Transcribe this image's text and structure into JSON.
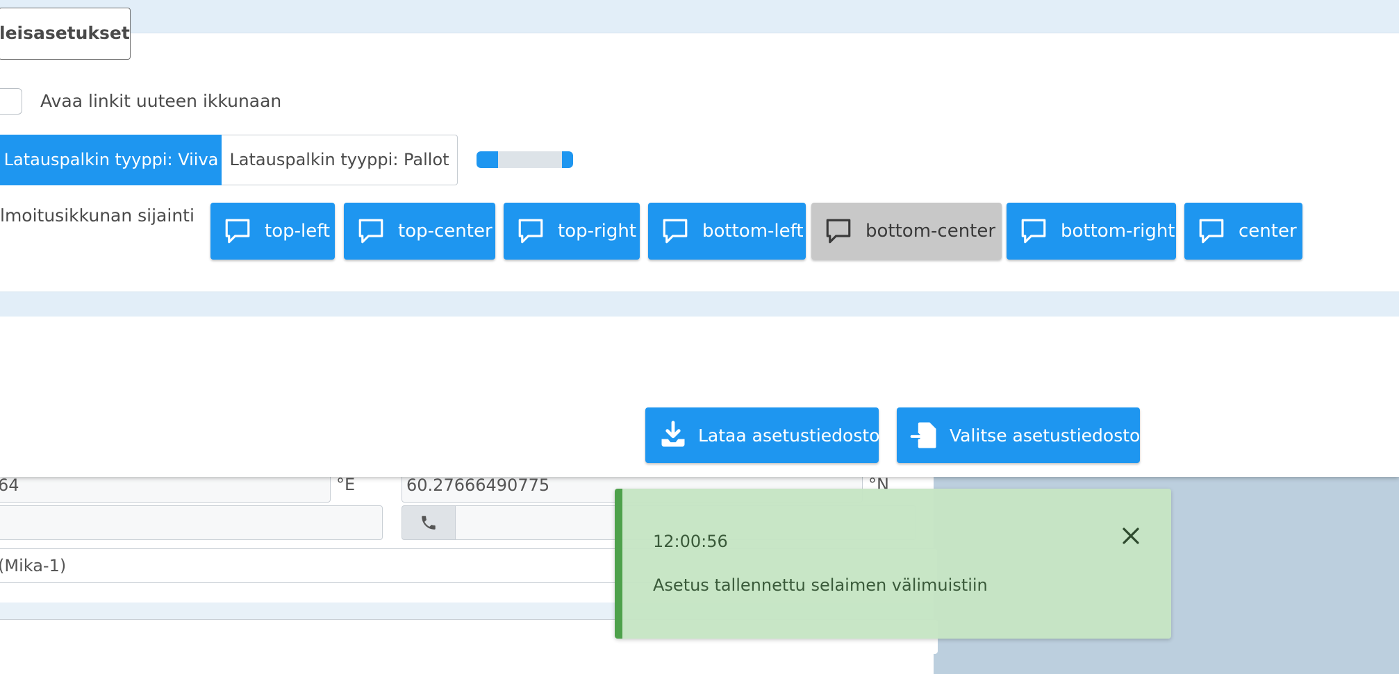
{
  "background_form": {
    "lon_value": "64",
    "lon_unit": "°E",
    "lat_value": "60.27666490775",
    "lat_unit": "°N",
    "phone_icon": "phone-icon",
    "owner_value": "(Mika-1)"
  },
  "panel": {
    "general_tab_label": "leisasetukset",
    "checkbox": {
      "label": "Avaa linkit uuteen ikkunaan",
      "checked": false
    },
    "loader_type": {
      "options": [
        "Latauspalkin tyyppi: Viiva",
        "Latauspalkin tyyppi: Pallot"
      ],
      "selected": "Latauspalkin tyyppi: Viiva"
    },
    "notification_position": {
      "label": "lmoitusikkunan sijainti",
      "icon": "message-bubble-icon",
      "options": [
        "top-left",
        "top-center",
        "top-right",
        "bottom-left",
        "bottom-center",
        "bottom-right",
        "center"
      ],
      "selected": "bottom-center"
    },
    "actions": {
      "download_label": "Lataa asetustiedosto",
      "download_icon": "download-icon",
      "choose_label": "Valitse asetustiedosto",
      "choose_icon": "file-import-icon"
    }
  },
  "notification": {
    "time": "12:00:56",
    "message": "Asetus tallennettu selaimen välimuistiin",
    "close_icon": "close-icon"
  },
  "colors": {
    "primary": "#1e96f0",
    "active_button": "#c8c8c8",
    "success_bg": "#c6e5c4",
    "success_border": "#4ea14b",
    "band": "#e2eef8"
  }
}
